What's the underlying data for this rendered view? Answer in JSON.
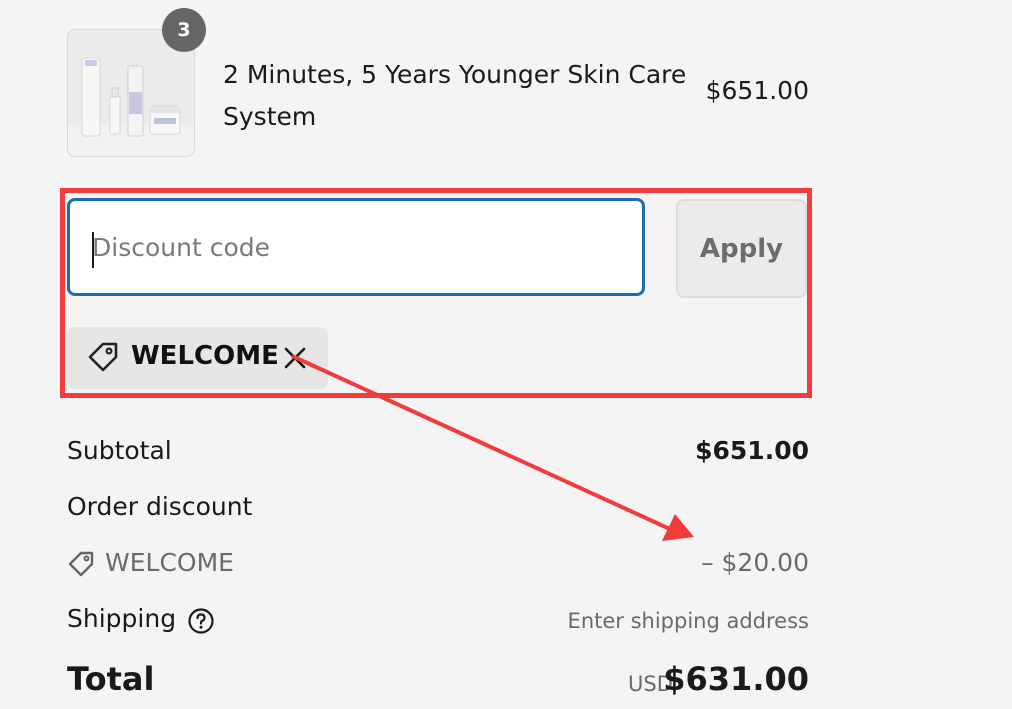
{
  "product": {
    "name": "2 Minutes, 5 Years Younger Skin Care System",
    "price": "$651.00",
    "quantity": "3",
    "image_icon": "product-thumbnail"
  },
  "discount": {
    "placeholder": "Discount code",
    "value": "",
    "apply_label": "Apply",
    "applied_code": "WELCOME"
  },
  "summary": {
    "subtotal_label": "Subtotal",
    "subtotal_value": "$651.00",
    "order_discount_label": "Order discount",
    "discount_code": "WELCOME",
    "discount_value": "– $20.00",
    "shipping_label": "Shipping",
    "shipping_value": "Enter shipping address",
    "total_label": "Total",
    "currency": "USD",
    "total_value": "$631.00"
  },
  "colors": {
    "background": "#f4f4f4",
    "input_focus_border": "#1f6cae",
    "annotation_red": "#f23b3b",
    "badge": "#666666"
  }
}
